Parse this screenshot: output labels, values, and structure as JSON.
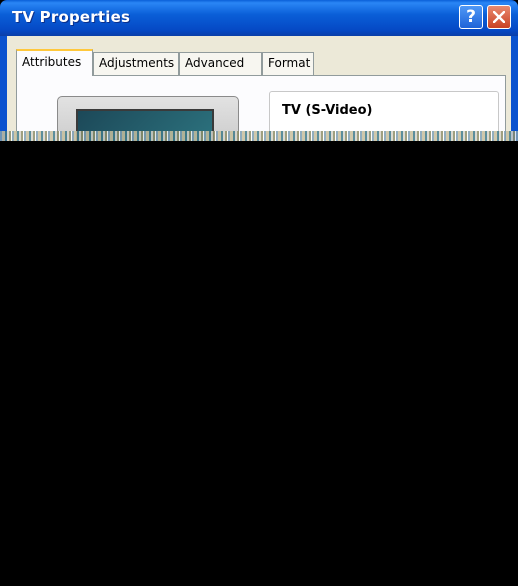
{
  "window": {
    "title": "TV Properties",
    "help_button": "?",
    "close_icon": "close-x-icon"
  },
  "tabs": [
    {
      "label": "Attributes",
      "active": true
    },
    {
      "label": "Adjustments",
      "active": false
    },
    {
      "label": "Advanced",
      "active": false
    },
    {
      "label": "Format",
      "active": false
    }
  ],
  "attributes": {
    "device_name": "TV (S-Video)",
    "device_icon": "tv-monitor-icon"
  },
  "colors": {
    "titlebar": "#0a5fd8",
    "active_tab_accent": "#ffc83c",
    "dialog_background": "#ece9d8"
  }
}
